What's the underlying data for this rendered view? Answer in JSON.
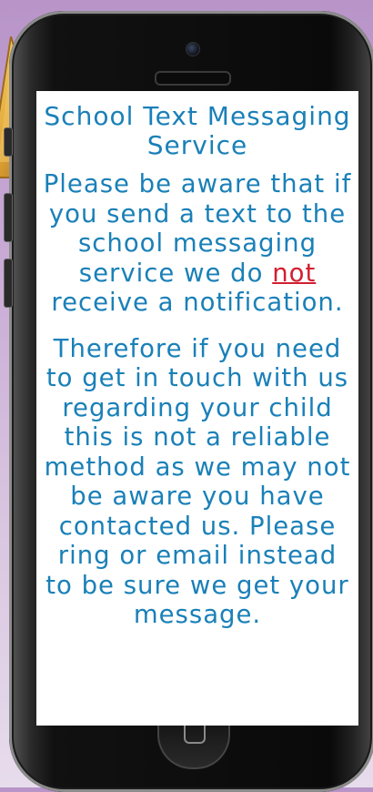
{
  "screen": {
    "title": "School Text Messaging Service",
    "paragraph1": {
      "part1": "Please be aware that if you send a text to the school messaging service we do ",
      "emphasis": "not",
      "part2": " receive a notification."
    },
    "paragraph2": "Therefore if you need to get in touch with us regarding your child this is not a reliable method as we may not be aware you have contacted us. Please ring or email instead to be sure we get your message."
  },
  "colors": {
    "text": "#1a80b8",
    "emphasis": "#d21f30",
    "background": "#ffffff"
  },
  "icons": {
    "camera": "camera-icon",
    "home": "home-button-icon"
  }
}
